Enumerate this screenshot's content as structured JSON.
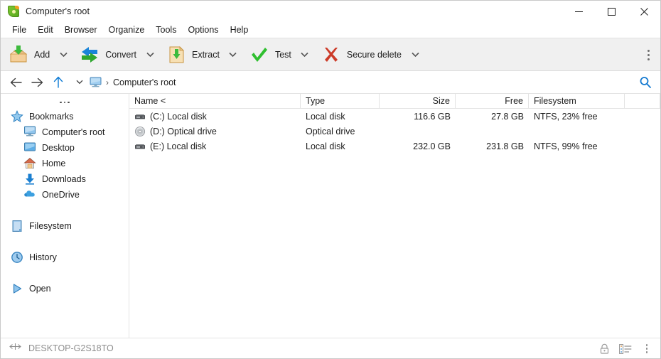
{
  "window": {
    "title": "Computer's root",
    "app_icon": "peazip-pea-icon",
    "controls": {
      "minimize": "minimize-icon",
      "maximize": "maximize-icon",
      "close": "close-icon"
    }
  },
  "menubar": {
    "items": [
      {
        "label": "File"
      },
      {
        "label": "Edit"
      },
      {
        "label": "Browser"
      },
      {
        "label": "Organize"
      },
      {
        "label": "Tools"
      },
      {
        "label": "Options"
      },
      {
        "label": "Help"
      }
    ]
  },
  "toolbar": {
    "buttons": [
      {
        "label": "Add",
        "icon": "add-box-icon",
        "has_dropdown": true
      },
      {
        "label": "Convert",
        "icon": "convert-arrows-icon",
        "has_dropdown": true
      },
      {
        "label": "Extract",
        "icon": "extract-folder-icon",
        "has_dropdown": true
      },
      {
        "label": "Test",
        "icon": "check-mark-icon",
        "has_dropdown": true
      },
      {
        "label": "Secure delete",
        "icon": "red-cross-icon",
        "has_dropdown": true
      }
    ],
    "overflow": "toolbar-overflow-icon"
  },
  "addressbar": {
    "back": "back-arrow-icon",
    "forward": "forward-arrow-icon",
    "up": "up-arrow-icon",
    "history_caret": "chevron-down-icon",
    "root_icon": "computer-monitor-icon",
    "separator": "›",
    "path": "Computer's root",
    "search": "search-icon"
  },
  "sidebar": {
    "more_icon": "sidebar-more-dots-icon",
    "groups": [
      {
        "items": [
          {
            "label": "Bookmarks",
            "icon": "star-icon",
            "level": 0
          },
          {
            "label": "Computer's root",
            "icon": "computer-monitor-icon",
            "level": 1
          },
          {
            "label": "Desktop",
            "icon": "desktop-icon",
            "level": 1
          },
          {
            "label": "Home",
            "icon": "home-icon",
            "level": 1
          },
          {
            "label": "Downloads",
            "icon": "download-arrow-icon",
            "level": 1
          },
          {
            "label": "OneDrive",
            "icon": "cloud-icon",
            "level": 1
          }
        ]
      },
      {
        "items": [
          {
            "label": "Filesystem",
            "icon": "filesystem-icon",
            "level": 0
          }
        ]
      },
      {
        "items": [
          {
            "label": "History",
            "icon": "clock-icon",
            "level": 0
          }
        ]
      },
      {
        "items": [
          {
            "label": "Open",
            "icon": "play-triangle-icon",
            "level": 0
          }
        ]
      }
    ]
  },
  "filelist": {
    "columns": [
      {
        "key": "name",
        "label": "Name <",
        "align": "left"
      },
      {
        "key": "type",
        "label": "Type",
        "align": "left"
      },
      {
        "key": "size",
        "label": "Size",
        "align": "right"
      },
      {
        "key": "free",
        "label": "Free",
        "align": "right"
      },
      {
        "key": "filesystem",
        "label": "Filesystem",
        "align": "left"
      },
      {
        "key": "extra",
        "label": "",
        "align": "left"
      }
    ],
    "sort_column": "Name",
    "rows": [
      {
        "icon": "hard-disk-icon",
        "name": "(C:) Local disk",
        "type": "Local disk",
        "size": "116.6 GB",
        "free": "27.8 GB",
        "filesystem": "NTFS, 23% free"
      },
      {
        "icon": "optical-disc-icon",
        "name": "(D:) Optical drive",
        "type": "Optical drive",
        "size": "",
        "free": "",
        "filesystem": ""
      },
      {
        "icon": "hard-disk-icon",
        "name": "(E:) Local disk",
        "type": "Local disk",
        "size": "232.0 GB",
        "free": "231.8 GB",
        "filesystem": "NTFS, 99% free"
      }
    ]
  },
  "statusbar": {
    "resize_icon": "horizontal-resize-icon",
    "computer_name": "DESKTOP-G2S18TO",
    "lock_icon": "padlock-icon",
    "view_icon": "details-view-icon",
    "overflow_icon": "status-overflow-icon"
  },
  "colors": {
    "accent_blue": "#0078d7",
    "green": "#39b54a",
    "red": "#cc3b28",
    "orange": "#e8a33d",
    "toolbar_bg": "#f0f0f0",
    "text": "#1c1c1c",
    "muted_text": "#8d8d8d",
    "border": "#e3e3e3"
  }
}
